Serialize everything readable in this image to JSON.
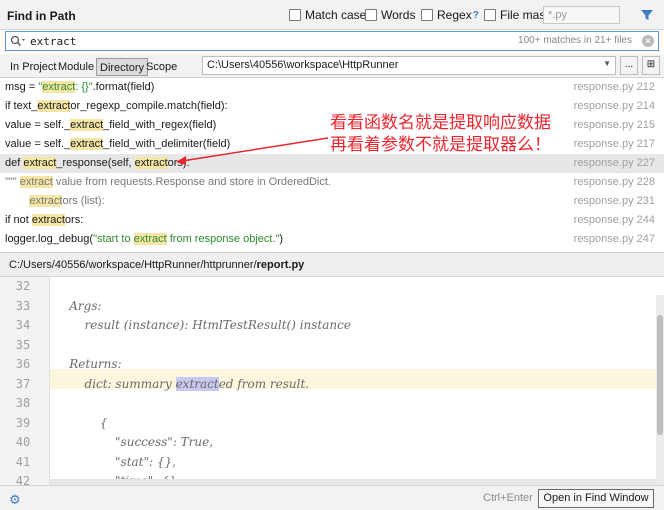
{
  "window": {
    "title": "Find in Path"
  },
  "options": {
    "match_case": "Match case",
    "words": "Words",
    "regex": "Regex",
    "regex_help": "?",
    "file_mask": "File mask:",
    "file_mask_value": "*.py"
  },
  "search": {
    "query": "extract",
    "match_count": "100+ matches in 21+ files"
  },
  "scope": {
    "tabs": [
      "In Project",
      "Module",
      "Directory",
      "Scope"
    ],
    "active_tab": "Directory",
    "directory": "C:\\Users\\40556\\workspace\\HttpRunner",
    "browse_label": "...",
    "recursive_label": "⊞"
  },
  "results": [
    {
      "pre": "msg = ",
      "q1": "\"",
      "hl": "extract",
      "q2": ": {}\"",
      "post": ".format(field)",
      "loc": "response.py 212"
    },
    {
      "pre": "if text_",
      "hl": "extract",
      "post": "or_regexp_compile.match(field):",
      "loc": "response.py 214"
    },
    {
      "pre": "value = self._",
      "hl": "extract",
      "post": "_field_with_regex(field)",
      "loc": "response.py 215"
    },
    {
      "pre": "value = self._",
      "hl": "extract",
      "post": "_field_with_delimiter(field)",
      "loc": "response.py 217"
    },
    {
      "pre": "def ",
      "hl": "extract",
      "mid": "_response(self, ",
      "hl2": "extract",
      "post": "ors):",
      "loc": "response.py 227"
    },
    {
      "pre": "\"\"\" ",
      "hl": "extract",
      "post": " value from requests.Response and store in OrderedDict.",
      "loc": "response.py 228"
    },
    {
      "pre": "        ",
      "hl": "extract",
      "post": "ors (list):",
      "loc": "response.py 231"
    },
    {
      "pre": "if not ",
      "hl": "extract",
      "post": "ors:",
      "loc": "response.py 244"
    },
    {
      "pre": "logger.log_debug(",
      "s1": "\"start to ",
      "hl": "extract",
      "s2": " from response object.\"",
      "post": ")",
      "loc": "response.py 247"
    }
  ],
  "annotation": {
    "line1": "看看函数名就是提取响应数据",
    "line2": "再看着参数不就是提取器么！",
    "color": "#e8262f"
  },
  "preview": {
    "path_prefix": "C:/Users/40556/workspace/HttpRunner/httprunner/",
    "file": "report.py",
    "lines": [
      {
        "n": "32",
        "text": ""
      },
      {
        "n": "33",
        "text": "    Args:"
      },
      {
        "n": "34",
        "text": "        result (instance): HtmlTestResult() instance"
      },
      {
        "n": "35",
        "text": ""
      },
      {
        "n": "36",
        "text": "    Returns:"
      },
      {
        "n": "37",
        "a": "        dict: summary ",
        "sel": "extract",
        "b": "ed from result."
      },
      {
        "n": "38",
        "text": ""
      },
      {
        "n": "39",
        "text": "            {"
      },
      {
        "n": "40",
        "text": "                \"success\": True,"
      },
      {
        "n": "41",
        "text": "                \"stat\": {},"
      },
      {
        "n": "42",
        "text": "                \"time\": {},"
      }
    ]
  },
  "footer": {
    "shortcut": "Ctrl+Enter",
    "open_button": "Open in Find Window"
  },
  "colors": {
    "highlight": "#f5e6a6",
    "accent": "#3c7cc6"
  }
}
